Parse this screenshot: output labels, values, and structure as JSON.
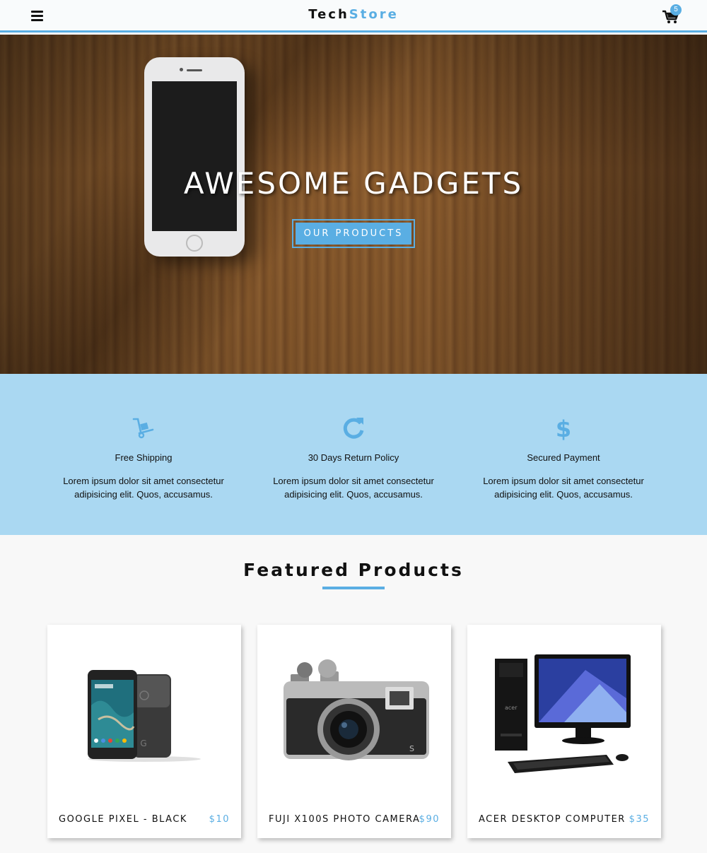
{
  "navbar": {
    "brand_part1": "Tech",
    "brand_part2": "Store",
    "cart_count": "5",
    "menu_icon": "hamburger-icon",
    "cart_icon": "shopping-cart-icon"
  },
  "hero": {
    "title": "AWESOME GADGETS",
    "button_label": "OUR PRODUCTS"
  },
  "features": [
    {
      "icon": "hand-truck-icon",
      "title": "Free Shipping",
      "text": "Lorem ipsum dolor sit amet consectetur adipisicing elit. Quos, accusamus."
    },
    {
      "icon": "refresh-icon",
      "title": "30 Days Return Policy",
      "text": "Lorem ipsum dolor sit amet consectetur adipisicing elit. Quos, accusamus."
    },
    {
      "icon": "dollar-icon",
      "title": "Secured Payment",
      "text": "Lorem ipsum dolor sit amet consectetur adipisicing elit. Quos, accusamus."
    }
  ],
  "featured": {
    "title": "Featured Products",
    "products": [
      {
        "name": "GOOGLE PIXEL - BLACK",
        "price": "$10",
        "image": "smartphone-image"
      },
      {
        "name": "FUJI X100S PHOTO CAMERA",
        "price": "$90",
        "image": "camera-image"
      },
      {
        "name": "ACER DESKTOP COMPUTER",
        "price": "$35",
        "image": "desktop-computer-image"
      }
    ]
  },
  "colors": {
    "accent": "#5aaee3",
    "features_bg": "#aad8f2",
    "page_bg": "#f8f8f8"
  }
}
